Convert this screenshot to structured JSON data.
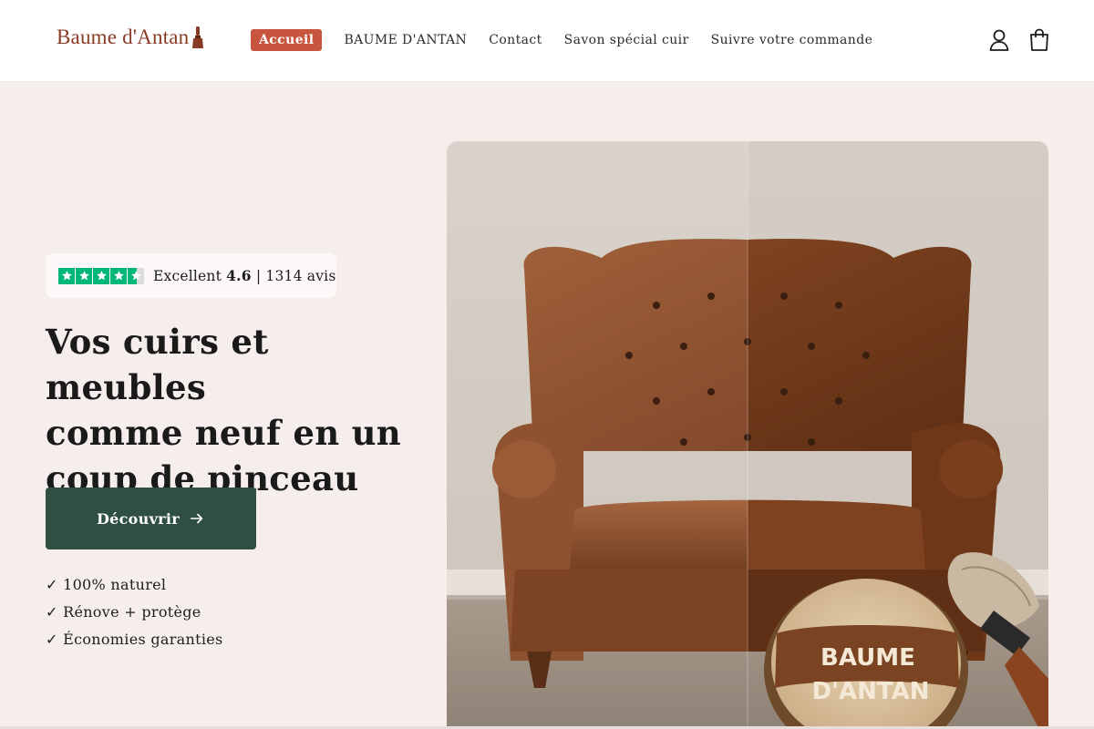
{
  "header": {
    "logo_text": "Baume d'Antan",
    "nav": [
      {
        "label": "Accueil",
        "active": true
      },
      {
        "label": "BAUME D'ANTAN",
        "active": false
      },
      {
        "label": "Contact",
        "active": false
      },
      {
        "label": "Savon spécial cuir",
        "active": false
      },
      {
        "label": "Suivre votre commande",
        "active": false
      }
    ],
    "icons": [
      "account-icon",
      "cart-icon"
    ]
  },
  "hero": {
    "rating": {
      "stars": 4.6,
      "prefix": "Excellent ",
      "score": "4.6",
      "suffix": " | 1314 avis"
    },
    "title_lines": [
      "Vos cuirs et meubles",
      "comme neuf en un",
      "coup de pinceau"
    ],
    "cta_label": "Découvrir",
    "benefits": [
      "✓ 100% naturel",
      "✓ Rénove + protège",
      "✓ Économies garanties"
    ],
    "product_label_line1": "BAUME",
    "product_label_line2": "D'ANTAN"
  },
  "colors": {
    "brand": "#8a3b26",
    "accent": "#c8553d",
    "cta": "#2f4f42",
    "background": "#f5eeec",
    "trustpilot": "#00b67a"
  }
}
